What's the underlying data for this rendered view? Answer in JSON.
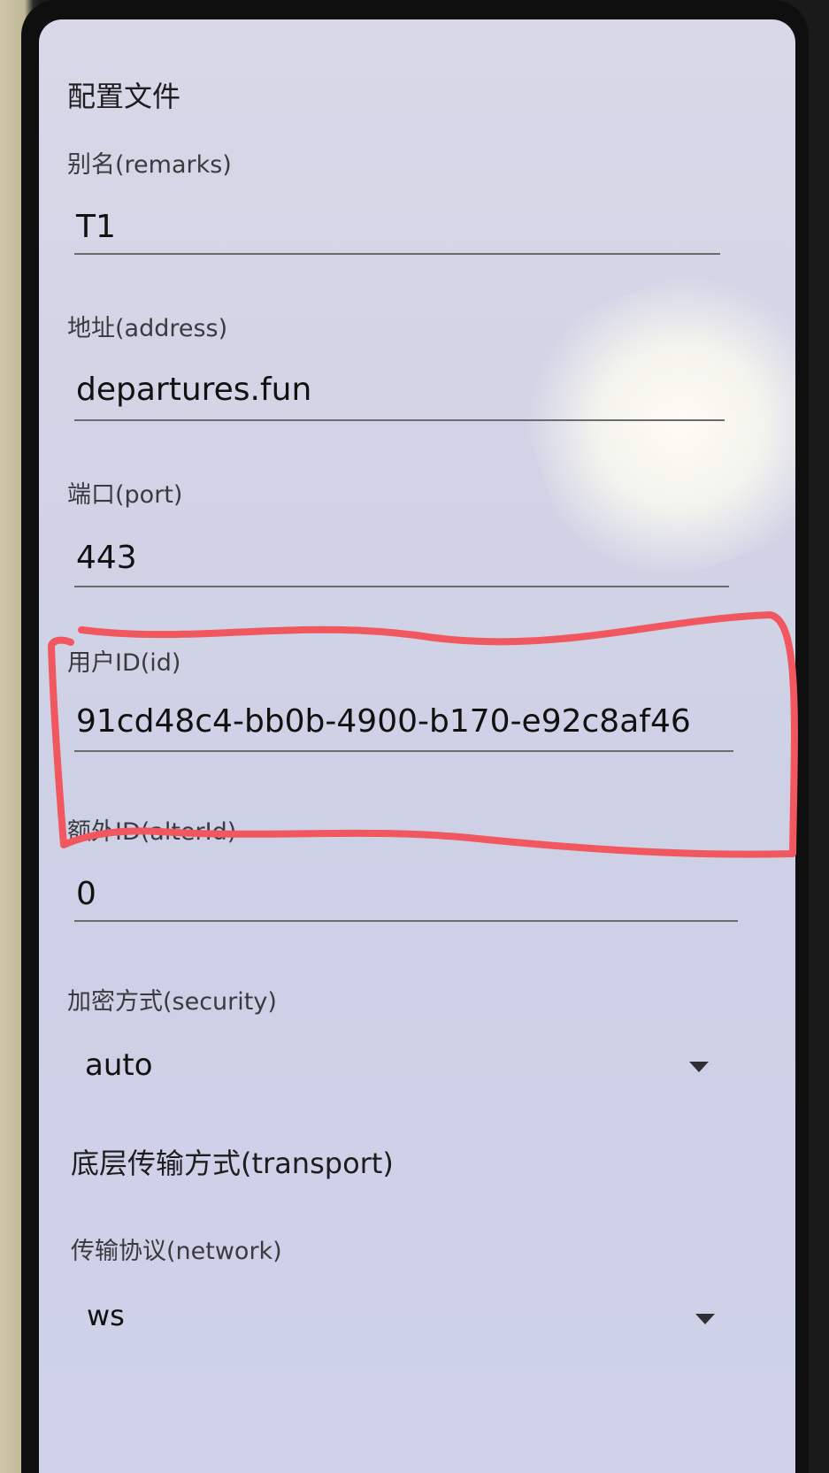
{
  "header": {
    "back_glyph": "‹"
  },
  "profile_section": {
    "title": "配置文件"
  },
  "fields": {
    "remarks": {
      "label": "别名(remarks)",
      "value": "T1"
    },
    "address": {
      "label": "地址(address)",
      "value": "departures.fun"
    },
    "port": {
      "label": "端口(port)",
      "value": "443"
    },
    "id": {
      "label": "用户ID(id)",
      "value": "91cd48c4-bb0b-4900-b170-e92c8af46"
    },
    "alterId": {
      "label": "额外ID(alterId)",
      "value": "0"
    },
    "security": {
      "label": "加密方式(security)",
      "value": "auto"
    }
  },
  "transport_section": {
    "title": "底层传输方式(transport)"
  },
  "transport_fields": {
    "network": {
      "label": "传输协议(network)",
      "value": "ws"
    }
  },
  "colors": {
    "annotation_stroke": "#f0575f",
    "screen_background": "#d2d3e6"
  },
  "icons": {
    "dropdown": "triangle-down-icon"
  }
}
